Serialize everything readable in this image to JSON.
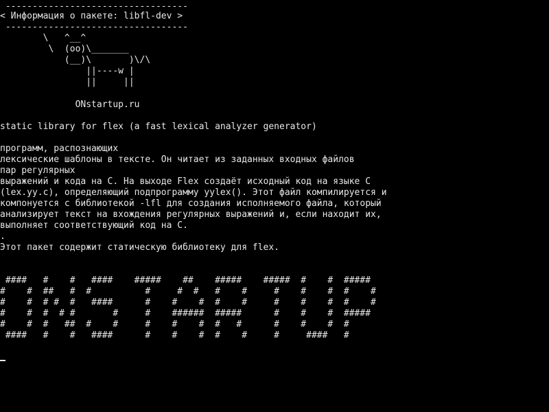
{
  "terminal": {
    "background_color": "#000000",
    "text_color": "#e8e8e8",
    "banner": {
      "border_top": " ----------------------------------",
      "message": "< Информация о пакете: libfl-dev >",
      "border_bottom": " ----------------------------------"
    },
    "cow": [
      "        \\   ^__^",
      "         \\  (oo)\\_______",
      "            (__)\\       )\\/\\",
      "                ||----w |",
      "                ||     ||"
    ],
    "site_label": "              ONstartup.ru",
    "summary": "static library for flex (a fast lexical analyzer generator)",
    "description": [
      "программ, распознающих",
      "лексические шаблоны в тексте. Он читает из заданных входных файлов",
      "пар регулярных",
      "выражений и кода на C. На выходе Flex создаёт исходный код на языке C",
      "(lex.yy.c), определяющий подпрограмму yylex(). Этот файл компилируется и",
      "компонуется с библиотекой -lfl для создания исполняемого файла, который",
      "анализирует текст на вхождения регулярных выражений и, если находит их,",
      "выполняет соответствующий код на C.",
      "."
    ],
    "package_note": "Этот пакет содержит статическую библиотеку для flex.",
    "ascii_art": [
      " ####   #    #   ####    #####    ##    #####    #####  #    #  #####",
      "#    #  ##   #  #          #     #  #   #    #     #    #    #  #    #",
      "#    #  # #  #   ####      #    #    #  #    #     #    #    #  #    #",
      "#    #  #  # #       #     #    ######  #####      #    #    #  #####",
      "#    #  #   ##  #    #     #    #    #  #   #      #    #    #  #",
      " ####   #    #   ####      #    #    #  #    #     #     ####   #"
    ]
  }
}
